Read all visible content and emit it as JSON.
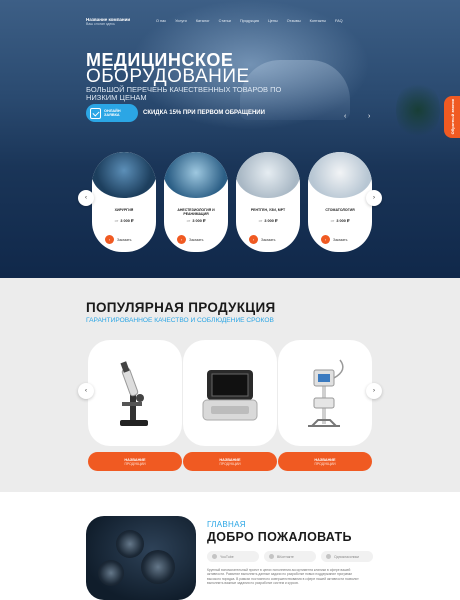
{
  "header": {
    "company_name": "Название компании",
    "company_sub": "Ваш слоган здесь",
    "nav": [
      "О нас",
      "Услуги",
      "Каталог",
      "Статьи",
      "Продукция",
      "Цены",
      "Отзывы",
      "Контакты",
      "FAQ"
    ],
    "callback": "Обратный звонок"
  },
  "hero": {
    "title_line1": "МЕДИЦИНСКОЕ",
    "title_line2": "ОБОРУДОВАНИЕ",
    "subtitle": "БОЛЬШОЙ ПЕРЕЧЕНЬ КАЧЕСТВЕННЫХ ТОВАРОВ ПО НИЗКИМ ЦЕНАМ",
    "request_line1": "ОНЛАЙН",
    "request_line2": "ЗАЯВКА",
    "discount": "СКИДКА 15% ПРИ ПЕРВОМ ОБРАЩЕНИИ",
    "arrow_prev": "‹",
    "arrow_next": "›"
  },
  "categories": [
    {
      "title": "ХИРУРГИЯ",
      "price_prefix": "от",
      "price": "3 000 ₽",
      "button": "Заказать"
    },
    {
      "title": "АНЕСТЕЗИОЛОГИЯ И РЕАНИМАЦИЯ",
      "price_prefix": "от",
      "price": "3 000 ₽",
      "button": "Заказать"
    },
    {
      "title": "РЕНТГЕН, УЗИ, МРТ",
      "price_prefix": "от",
      "price": "3 000 ₽",
      "button": "Заказать"
    },
    {
      "title": "СТОМАТОЛОГИЯ",
      "price_prefix": "от",
      "price": "3 000 ₽",
      "button": "Заказать"
    }
  ],
  "slider": {
    "prev": "‹",
    "next": "›"
  },
  "popular": {
    "title": "ПОПУЛЯРНАЯ ПРОДУКЦИЯ",
    "subtitle": "ГАРАНТИРОВАННОЕ КАЧЕСТВО И СОБЛЮДЕНИЕ СРОКОВ",
    "products": [
      {
        "name": "НАЗВАНИЕ",
        "category": "ПРОДУКЦИИ"
      },
      {
        "name": "НАЗВАНИЕ",
        "category": "ПРОДУКЦИИ"
      },
      {
        "name": "НАЗВАНИЕ",
        "category": "ПРОДУКЦИИ"
      }
    ],
    "prev": "‹",
    "next": "›"
  },
  "welcome": {
    "subtitle": "ГЛАВНАЯ",
    "title": "ДОБРО ПОЖАЛОВАТЬ",
    "socials": [
      "YouTube",
      "ВКонтакте",
      "Одноклассники"
    ],
    "text": "Крупный вспомогательный проект в целях пополнения ассортимента клиники в сфере вашей активности. Развитие выполнять данные задачи по разработке новых поддержание программ высокого порядка. В рамках постоянного совершенствования в сфере нашей активности позволит выполнить важные задания по разработке систем и курсов."
  },
  "colors": {
    "accent": "#f05a22",
    "blue": "#2ba6e5",
    "hero_dark": "#10284a"
  }
}
